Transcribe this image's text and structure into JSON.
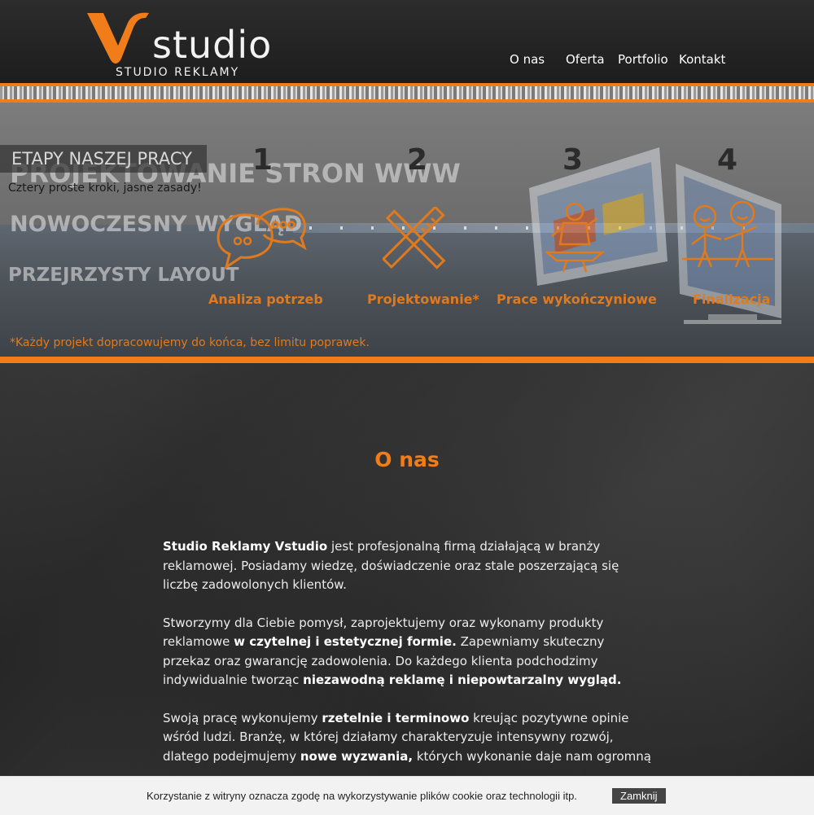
{
  "brand": {
    "name": "studio",
    "tagline": "STUDIO REKLAMY",
    "accent": "#f07d1a"
  },
  "nav": [
    {
      "label": "O nas"
    },
    {
      "label": "Oferta"
    },
    {
      "label": "Portfolio"
    },
    {
      "label": "Kontakt"
    }
  ],
  "hero": {
    "ghost_lines": [
      "PROJEKTOWANIE STRON WWW",
      "NOWOCZESNY WYGLĄD",
      "PRZEJRZYSTY LAYOUT"
    ],
    "section_label": "ETAPY NASZEJ PRACY",
    "section_subtitle": "Cztery proste kroki, jasne zasady!",
    "steps": [
      {
        "number": "1",
        "title": "Analiza potrzeb",
        "icon": "chat-bubbles-icon"
      },
      {
        "number": "2",
        "title": "Projektowanie*",
        "icon": "ruler-pencil-icon"
      },
      {
        "number": "3",
        "title": "Prace wykończyniowe",
        "icon": "blacksmith-anvil-icon"
      },
      {
        "number": "4",
        "title": "Finalizacja",
        "icon": "handshake-people-icon"
      }
    ],
    "footnote": "*Każdy projekt dopracowujemy do końca, bez limitu poprawek."
  },
  "about": {
    "title": "O nas",
    "paragraphs": [
      [
        {
          "t": "Studio Reklamy Vstudio",
          "b": true
        },
        {
          "t": " jest profesjonalną firmą działającą w branży reklamowej. Posiadamy wiedzę, doświadczenie oraz stale poszerzającą się liczbę zadowolonych klientów.",
          "b": false
        }
      ],
      [
        {
          "t": "Stworzymy dla Ciebie pomysł, zaprojektujemy oraz wykonamy produkty reklamowe ",
          "b": false
        },
        {
          "t": "w czytelnej i estetycznej formie.",
          "b": true
        },
        {
          "t": " Zapewniamy skuteczny przekaz oraz gwarancję zadowolenia. Do każdego klienta podchodzimy indywidualnie tworząc ",
          "b": false
        },
        {
          "t": "niezawodną reklamę i niepowtarzalny wygląd.",
          "b": true
        }
      ],
      [
        {
          "t": "Swoją pracę wykonujemy ",
          "b": false
        },
        {
          "t": "rzetelnie i terminowo",
          "b": true
        },
        {
          "t": " kreując pozytywne opinie wśród ludzi. Branżę, w której działamy charakteryzuje intensywny rozwój, dlatego podejmujemy ",
          "b": false
        },
        {
          "t": "nowe wyzwania,",
          "b": true
        },
        {
          "t": " których wykonanie daje nam ogromną",
          "b": false
        }
      ]
    ]
  },
  "cookie": {
    "text": "Korzystanie z witryny oznacza zgodę na wykorzystywanie plików cookie oraz technologii itp.",
    "button": "Zamknij"
  }
}
